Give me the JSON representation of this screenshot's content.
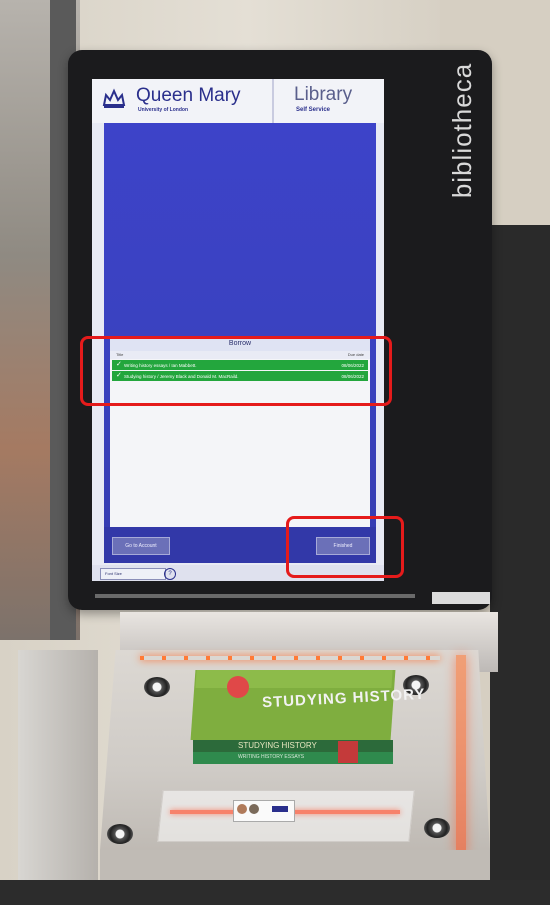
{
  "kiosk": {
    "brand": "bibliotheca"
  },
  "header": {
    "institution_name": "Queen Mary",
    "institution_sub": "University of London",
    "service_title": "Library",
    "service_sub": "Self Service"
  },
  "borrow": {
    "title": "Borrow",
    "col_title": "Title",
    "col_due": "Due date",
    "items": [
      {
        "title": "Writing history essays / Ian Mabbett.",
        "due": "08/06/2022"
      },
      {
        "title": "Studying history / Jeremy Black and Donald M. MacRaild.",
        "due": "08/06/2022"
      }
    ]
  },
  "buttons": {
    "account": "Go to Account",
    "finish": "Finished"
  },
  "footer": {
    "font_size": "Font Size",
    "help": "?"
  },
  "books": {
    "top_title": "STUDYING HISTORY",
    "spine1": "STUDYING HISTORY",
    "spine2": "WRITING HISTORY ESSAYS"
  },
  "colors": {
    "screen_blue": "#3d43c9",
    "checked_item": "#23a63d",
    "annotation": "#e51b1b"
  }
}
